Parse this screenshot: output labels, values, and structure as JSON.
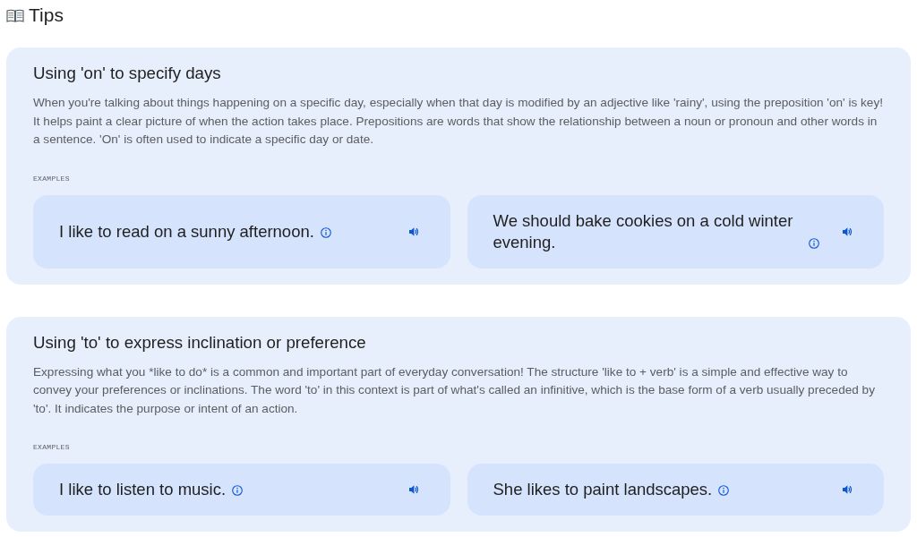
{
  "header": {
    "title": "Tips"
  },
  "tips": [
    {
      "title": "Using 'on' to specify days",
      "description": "When you're talking about things happening on a specific day, especially when that day is modified by an adjective like 'rainy', using the preposition 'on' is key! It helps paint a clear picture of when the action takes place. Prepositions are words that show the relationship between a noun or pronoun and other words in a sentence. 'On' is often used to indicate a specific day or date.",
      "examples_label": "EXAMPLES",
      "examples": [
        {
          "sentence": "I like to read on a sunny afternoon."
        },
        {
          "sentence": "We should bake cookies on a cold winter evening."
        }
      ]
    },
    {
      "title": "Using 'to' to express inclination or preference",
      "description": "Expressing what you *like to do* is a common and important part of everyday conversation! The structure 'like to + verb' is a simple and effective way to convey your preferences or inclinations. The word 'to' in this context is part of what's called an infinitive, which is the base form of a verb usually preceded by 'to'. It indicates the purpose or intent of an action.",
      "examples_label": "EXAMPLES",
      "examples": [
        {
          "sentence": "I like to listen to music."
        },
        {
          "sentence": "She likes to paint landscapes."
        }
      ]
    }
  ]
}
